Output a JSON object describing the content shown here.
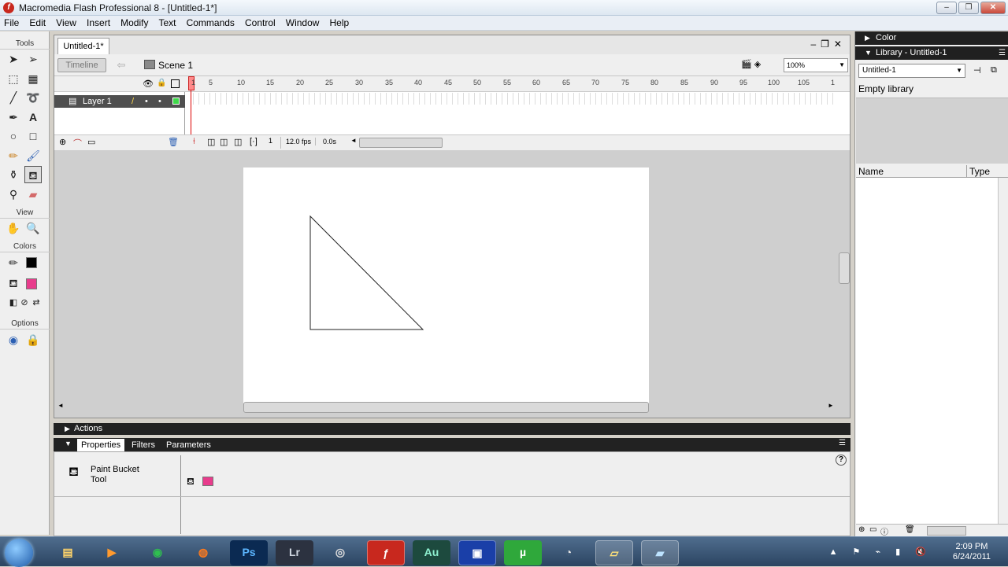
{
  "window": {
    "title": "Macromedia Flash Professional 8 - [Untitled-1*]",
    "app_icon": "flash-icon",
    "controls": [
      "minimize-icon",
      "maximize-icon",
      "close-icon"
    ]
  },
  "menu": [
    "File",
    "Edit",
    "View",
    "Insert",
    "Modify",
    "Text",
    "Commands",
    "Control",
    "Window",
    "Help"
  ],
  "tools_panel": {
    "section_tools": "Tools",
    "section_view": "View",
    "section_colors": "Colors",
    "section_options": "Options",
    "stroke_color": "#000000",
    "fill_color": "#e83c8c"
  },
  "document": {
    "tab": "Untitled-1*",
    "timeline_button": "Timeline",
    "scene_label": "Scene 1",
    "zoom": "100%"
  },
  "timeline": {
    "layer_name": "Layer 1",
    "ruler": [
      "1",
      "5",
      "10",
      "15",
      "20",
      "25",
      "30",
      "35",
      "40",
      "45",
      "50",
      "55",
      "60",
      "65",
      "70",
      "75",
      "80",
      "85",
      "90",
      "95",
      "100",
      "105",
      "1"
    ],
    "current_frame": "1",
    "fps": "12.0 fps",
    "elapsed": "0.0s"
  },
  "panels": {
    "actions": "Actions",
    "tab_properties": "Properties",
    "tab_filters": "Filters",
    "tab_parameters": "Parameters",
    "tool_name": "Paint Bucket Tool",
    "fill_color": "#e83c8c",
    "help": "?"
  },
  "library": {
    "color_panel": "Color",
    "library_panel": "Library - Untitled-1",
    "selected_doc": "Untitled-1",
    "empty_text": "Empty library",
    "col_name": "Name",
    "col_type": "Type"
  },
  "taskbar": {
    "time": "2:09 PM",
    "date": "6/24/2011",
    "apps": [
      "Ps",
      "Lr",
      "Au",
      "µ"
    ]
  }
}
